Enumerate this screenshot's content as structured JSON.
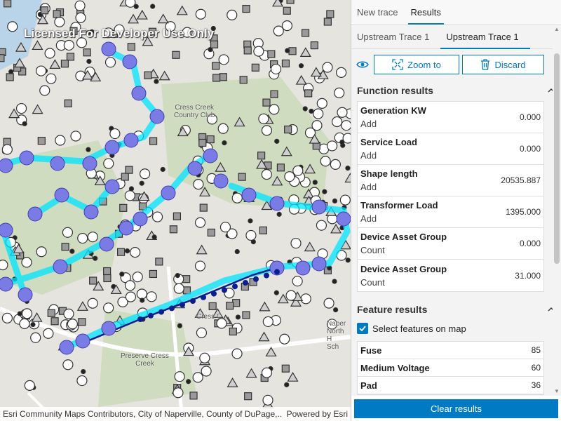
{
  "map": {
    "watermark": "Licensed For Developer Use Only",
    "labels": {
      "cress_creek_cc": "Cress Creek\nCountry Club",
      "preserve_cress_creek": "Preserve Cress\nCreek",
      "naperville_north_hs": "Naper\nNorth H\nSch",
      "cress_c": "Cress C",
      "summit_hills": "Summit Hills Ln"
    },
    "attribution": "Esri Community Maps Contributors, City of Naperville, County of DuPage,...",
    "powered_by": "Powered by Esri",
    "colors": {
      "trace": "#00e5ff",
      "trace_node": "#6a6ae0",
      "road": "#ffffff"
    }
  },
  "panel": {
    "tabs": [
      "New trace",
      "Results"
    ],
    "active_tab": "Results",
    "subtabs": [
      "Upstream Trace 1",
      "Upstream Trace 1"
    ],
    "actions": {
      "zoom_to": "Zoom to",
      "discard": "Discard"
    },
    "function_results": {
      "title": "Function results",
      "rows": [
        {
          "name": "Generation KW",
          "type": "Add",
          "value": "0.000"
        },
        {
          "name": "Service Load",
          "type": "Add",
          "value": "0.000"
        },
        {
          "name": "Shape length",
          "type": "Add",
          "value": "20535.887"
        },
        {
          "name": "Transformer Load",
          "type": "Add",
          "value": "1395.000"
        },
        {
          "name": "Device Asset Group",
          "type": "Count",
          "value": "0.000"
        },
        {
          "name": "Device Asset Group",
          "type": "Count",
          "value": "31.000"
        }
      ]
    },
    "feature_results": {
      "title": "Feature results",
      "select_on_map": "Select features on map",
      "rows": [
        {
          "name": "Fuse",
          "value": "85"
        },
        {
          "name": "Medium Voltage",
          "value": "60"
        },
        {
          "name": "Pad",
          "value": "36"
        }
      ]
    },
    "clear_results": "Clear results",
    "accent": "#007ac2"
  }
}
